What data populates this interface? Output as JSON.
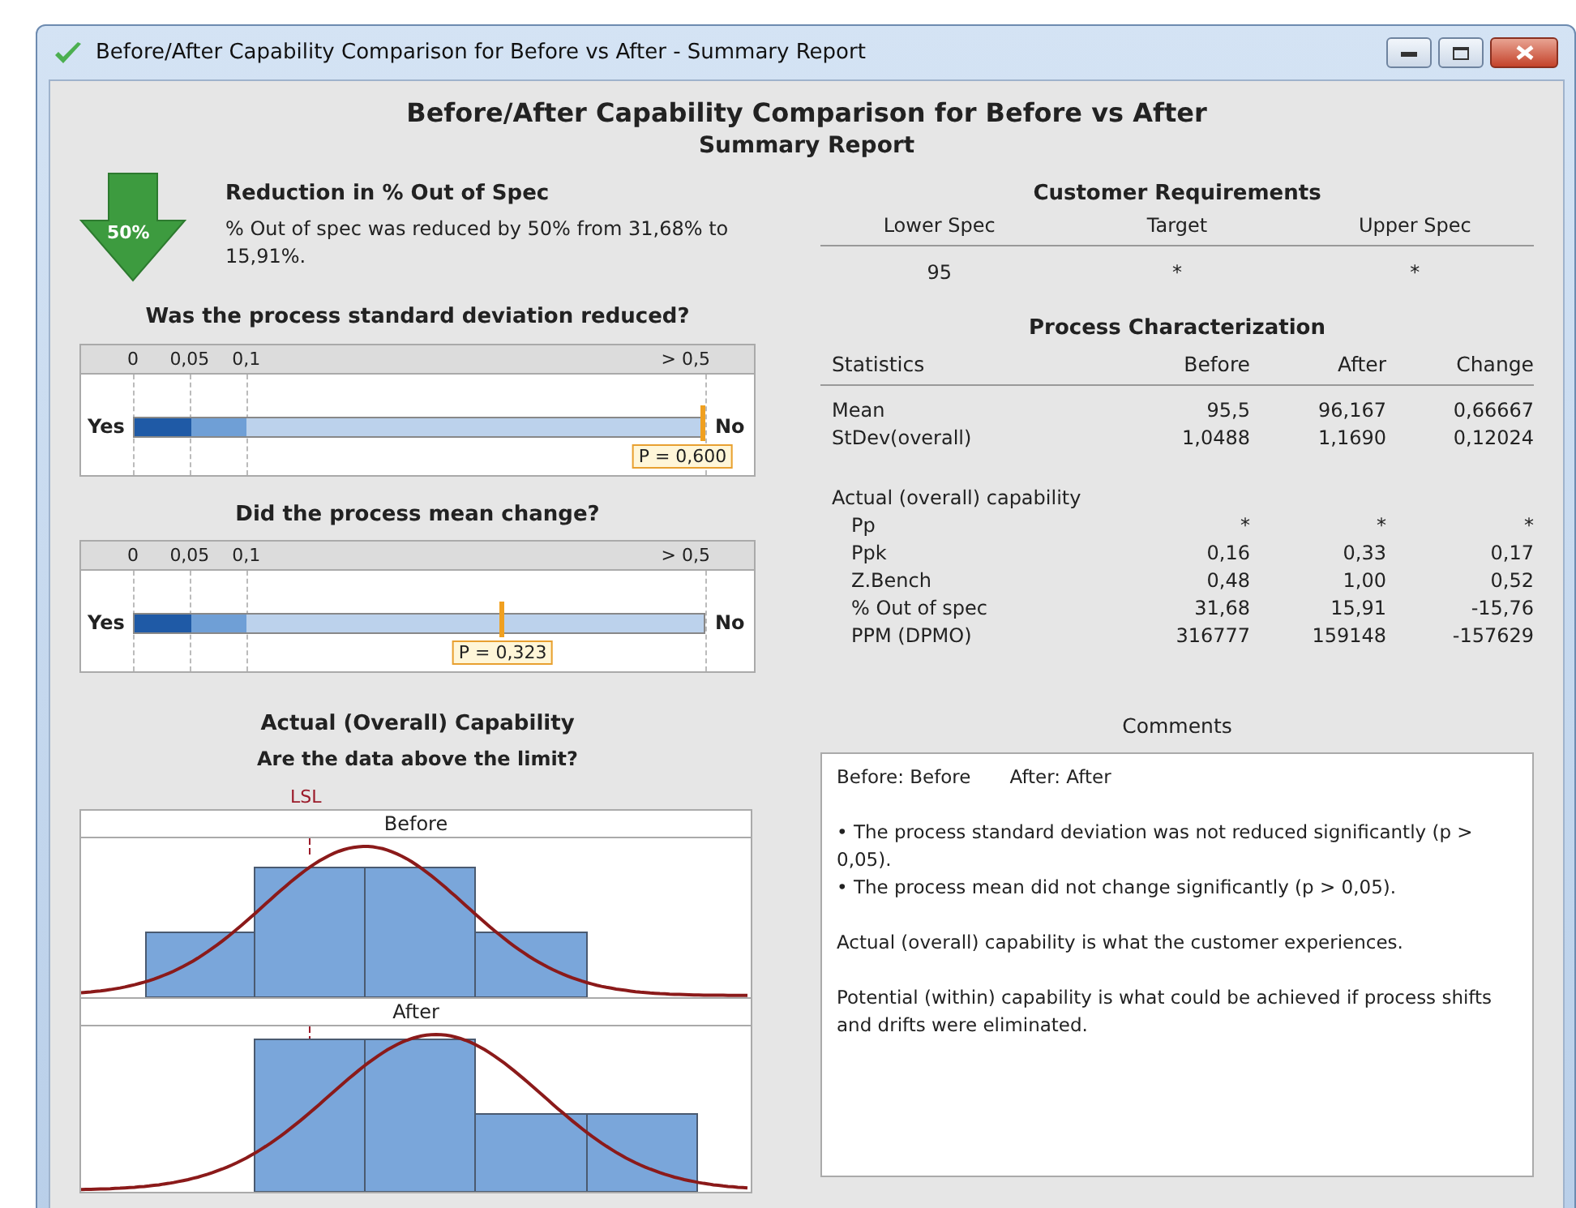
{
  "window": {
    "title": "Before/After Capability Comparison for Before vs After - Summary Report"
  },
  "report": {
    "title": "Before/After Capability Comparison for Before vs After",
    "subtitle": "Summary Report"
  },
  "reduction": {
    "arrow_label": "50%",
    "heading": "Reduction in % Out of Spec",
    "text": "% Out of spec was reduced by 50% from 31,68% to 15,91%."
  },
  "tests": [
    {
      "question": "Was the process standard deviation reduced?",
      "ticks": [
        "0",
        "0,05",
        "0,1",
        "> 0,5"
      ],
      "left_label": "Yes",
      "right_label": "No",
      "p_label": "P = 0,600",
      "level": 1.0
    },
    {
      "question": "Did the process mean change?",
      "ticks": [
        "0",
        "0,05",
        "0,1",
        "> 0,5"
      ],
      "left_label": "Yes",
      "right_label": "No",
      "p_label": "P = 0,323",
      "level": 0.646
    }
  ],
  "capability": {
    "title": "Actual (Overall) Capability",
    "subtitle": "Are the data above the limit?",
    "limit_label": "LSL",
    "panels": [
      {
        "label": "Before"
      },
      {
        "label": "After"
      }
    ]
  },
  "requirements": {
    "title": "Customer Requirements",
    "columns": [
      "Lower Spec",
      "Target",
      "Upper Spec"
    ],
    "values": [
      "95",
      "*",
      "*"
    ]
  },
  "characterization": {
    "title": "Process Characterization",
    "columns": [
      "Statistics",
      "Before",
      "After",
      "Change"
    ],
    "rows": [
      {
        "kind": "stat",
        "cells": [
          "Mean",
          "95,5",
          "96,167",
          "0,66667"
        ]
      },
      {
        "kind": "stat",
        "cells": [
          "StDev(overall)",
          "1,0488",
          "1,1690",
          "0,12024"
        ]
      },
      {
        "kind": "section",
        "cells": [
          "Actual (overall) capability"
        ]
      },
      {
        "kind": "indented",
        "cells": [
          "Pp",
          "*",
          "*",
          "*"
        ]
      },
      {
        "kind": "indented",
        "cells": [
          "Ppk",
          "0,16",
          "0,33",
          "0,17"
        ]
      },
      {
        "kind": "indented",
        "cells": [
          "Z.Bench",
          "0,48",
          "1,00",
          "0,52"
        ]
      },
      {
        "kind": "indented",
        "cells": [
          "% Out of spec",
          "31,68",
          "15,91",
          "-15,76"
        ]
      },
      {
        "kind": "indented",
        "cells": [
          "PPM (DPMO)",
          "316777",
          "159148",
          "-157629"
        ]
      }
    ]
  },
  "comments": {
    "title": "Comments",
    "paragraphs": [
      {
        "kind": "pair",
        "texts": [
          "Before: Before",
          "After: After"
        ]
      },
      {
        "kind": "bullet",
        "texts": [
          "• The process standard deviation was not reduced significantly (p > 0,05)."
        ]
      },
      {
        "kind": "bullet",
        "texts": [
          "• The process mean did not change significantly (p > 0,05)."
        ]
      },
      {
        "kind": "text",
        "texts": [
          "Actual (overall) capability is what the customer experiences."
        ]
      },
      {
        "kind": "text",
        "texts": [
          "Potential (within) capability is what could be achieved if process shifts and drifts were eliminated."
        ]
      }
    ]
  }
}
